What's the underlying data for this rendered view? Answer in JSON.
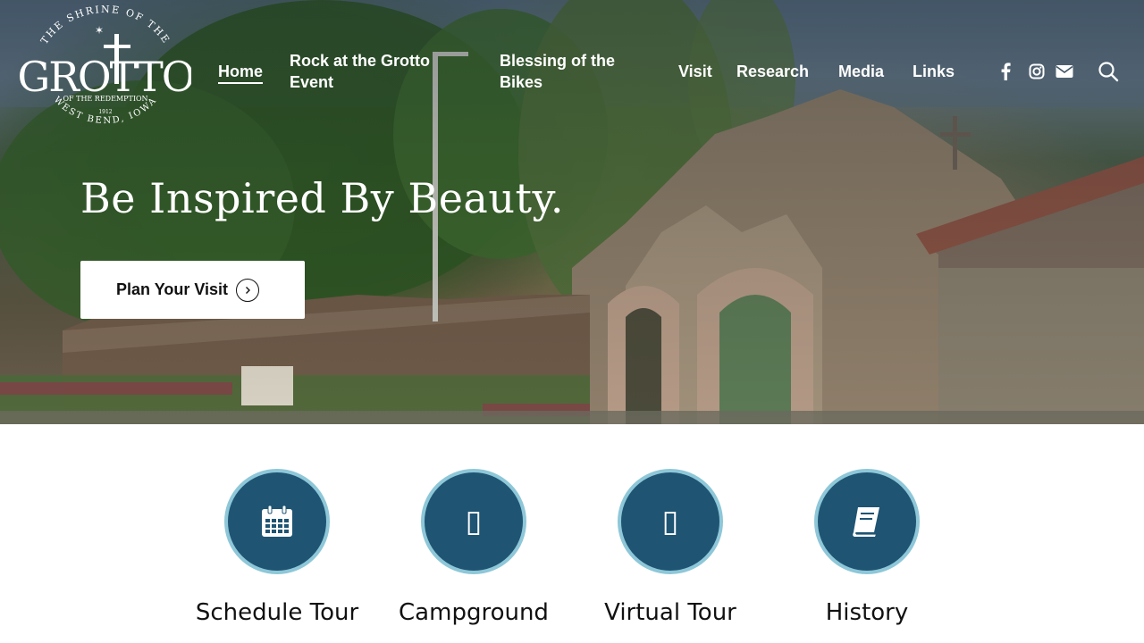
{
  "logo": {
    "arc_top": "THE SHRINE OF THE",
    "wordmark": "GROTTO",
    "subline": "OF THE REDEMPTION",
    "year": "1912",
    "arc_bottom": "WEST BEND, IOWA"
  },
  "nav": {
    "items": [
      {
        "label": "Home",
        "active": true
      },
      {
        "label_line1": "Rock at the Grotto",
        "label_line2": "Event"
      },
      {
        "label_line1": "Blessing of the",
        "label_line2": "Bikes"
      },
      {
        "label": "Visit"
      },
      {
        "label": "Research"
      },
      {
        "label": "Media"
      },
      {
        "label": "Links"
      }
    ],
    "social": [
      {
        "icon": "facebook-icon"
      },
      {
        "icon": "instagram-icon"
      },
      {
        "icon": "envelope-icon"
      }
    ],
    "search_icon": "search-icon"
  },
  "hero": {
    "headline": "Be Inspired By Beauty.",
    "cta_label": "Plan Your Visit",
    "cta_icon": "chevron-right-circle-icon"
  },
  "features": [
    {
      "label": "Schedule Tour",
      "icon": "calendar-icon"
    },
    {
      "label": "Campground",
      "icon": "missing-glyph-icon",
      "glyph": "▯"
    },
    {
      "label": "Virtual Tour",
      "icon": "missing-glyph-icon",
      "glyph": "▯"
    },
    {
      "label": "History",
      "icon": "book-icon"
    }
  ],
  "colors": {
    "feature_circle": "#1f5473",
    "feature_ring": "#8ec7d8",
    "text_dark": "#111111",
    "nav_text": "#ffffff"
  }
}
